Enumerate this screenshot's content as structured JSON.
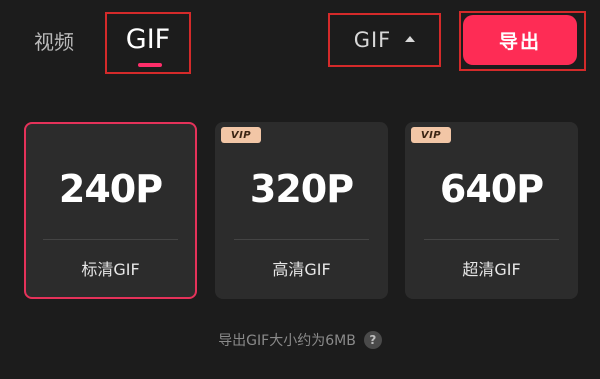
{
  "header": {
    "tabs": [
      {
        "label": "视频",
        "active": false
      },
      {
        "label": "GIF",
        "active": true
      }
    ],
    "format_dropdown": {
      "selected": "GIF",
      "icon": "caret-up-icon"
    },
    "export_button": {
      "label": "导出"
    }
  },
  "cards": [
    {
      "resolution": "240P",
      "label": "标清GIF",
      "vip": false,
      "selected": true
    },
    {
      "resolution": "320P",
      "label": "高清GIF",
      "vip": true,
      "vip_label": "VIP",
      "selected": false
    },
    {
      "resolution": "640P",
      "label": "超清GIF",
      "vip": true,
      "vip_label": "VIP",
      "selected": false
    }
  ],
  "footer": {
    "info": "导出GIF大小约为6MB",
    "help_icon": "?"
  },
  "colors": {
    "background": "#1c1c1c",
    "card": "#2c2c2c",
    "accent": "#fe2c55",
    "selected_border": "#e5325a",
    "vip_badge": "#f2c6a6"
  }
}
